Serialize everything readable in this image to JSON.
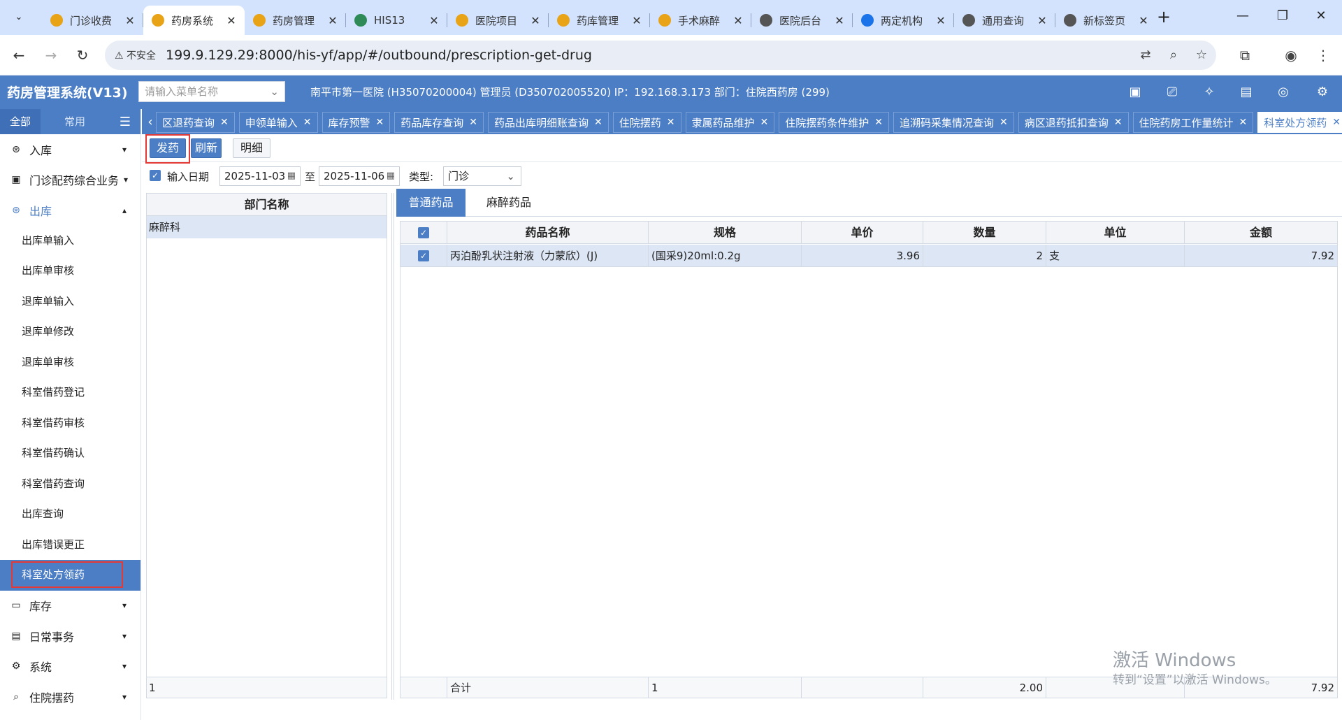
{
  "browser": {
    "tabs": [
      {
        "label": "门诊收费",
        "icon_color": "#e8a317"
      },
      {
        "label": "药房系统",
        "icon_color": "#e8a317",
        "active": true
      },
      {
        "label": "药房管理",
        "icon_color": "#e8a317"
      },
      {
        "label": "HIS13",
        "icon_color": "#2e8b57"
      },
      {
        "label": "医院项目",
        "icon_color": "#e8a317"
      },
      {
        "label": "药库管理",
        "icon_color": "#e8a317"
      },
      {
        "label": "手术麻醉",
        "icon_color": "#e8a317"
      },
      {
        "label": "医院后台",
        "icon_color": "#555555"
      },
      {
        "label": "两定机构",
        "icon_color": "#1a73e8"
      },
      {
        "label": "通用查询",
        "icon_color": "#555555"
      },
      {
        "label": "新标签页",
        "icon_color": "#555555"
      }
    ],
    "insecure_label": "不安全",
    "url": "199.9.129.29:8000/his-yf/app/#/outbound/prescription-get-drug"
  },
  "app": {
    "title": "药房管理系统(V13)",
    "menu_search_placeholder": "请输入菜单名称",
    "header_info": "南平市第一医院 (H35070200004) 管理员 (D350702005520) IP：192.168.3.173 部门：住院西药房 (299)"
  },
  "sidebar": {
    "tab_all": "全部",
    "tab_common": "常用",
    "groups": [
      {
        "label": "入库",
        "icon": "box-icon"
      },
      {
        "label": "门诊配药综合业务",
        "icon": "calendar-icon"
      },
      {
        "label": "出库",
        "icon": "gear-icon",
        "open": true
      }
    ],
    "sub_items": [
      "出库单输入",
      "出库单审核",
      "退库单输入",
      "退库单修改",
      "退库单审核",
      "科室借药登记",
      "科室借药审核",
      "科室借药确认",
      "科室借药查询",
      "出库查询",
      "出库错误更正",
      "科室处方领药"
    ],
    "bottom_groups": [
      {
        "label": "库存",
        "icon": "inventory-icon"
      },
      {
        "label": "日常事务",
        "icon": "calendar-icon"
      },
      {
        "label": "系统",
        "icon": "gear-icon"
      },
      {
        "label": "住院摆药",
        "icon": "search-icon"
      }
    ]
  },
  "page_tabs": [
    "区退药查询",
    "申领单输入",
    "库存预警",
    "药品库存查询",
    "药品出库明细账查询",
    "住院摆药",
    "隶属药品维护",
    "住院摆药条件维护",
    "追溯码采集情况查询",
    "病区退药抵扣查询",
    "住院药房工作量统计",
    "科室处方领药"
  ],
  "toolbar": {
    "dispense": "发药",
    "refresh": "刷新",
    "detail": "明细"
  },
  "filter": {
    "date_label": "输入日期",
    "date_from": "2025-11-03",
    "to_label": "至",
    "date_to": "2025-11-06",
    "type_label": "类型:",
    "type_value": "门诊"
  },
  "dept_grid": {
    "header": "部门名称",
    "rows": [
      "麻醉科"
    ],
    "footer": "1"
  },
  "drug_tabs": [
    "普通药品",
    "麻醉药品"
  ],
  "drug_grid": {
    "columns": [
      "药品名称",
      "规格",
      "单价",
      "数量",
      "单位",
      "金额"
    ],
    "rows": [
      {
        "name": "丙泊酚乳状注射液（力蒙欣）(J)",
        "spec": "(国采9)20ml:0.2g",
        "price": "3.96",
        "qty": "2",
        "unit": "支",
        "amount": "7.92"
      }
    ],
    "footer": {
      "label": "合计",
      "spec": "1",
      "qty": "2.00",
      "amount": "7.92"
    }
  },
  "watermark": {
    "line1": "激活 Windows",
    "line2": "转到“设置”以激活 Windows。"
  }
}
